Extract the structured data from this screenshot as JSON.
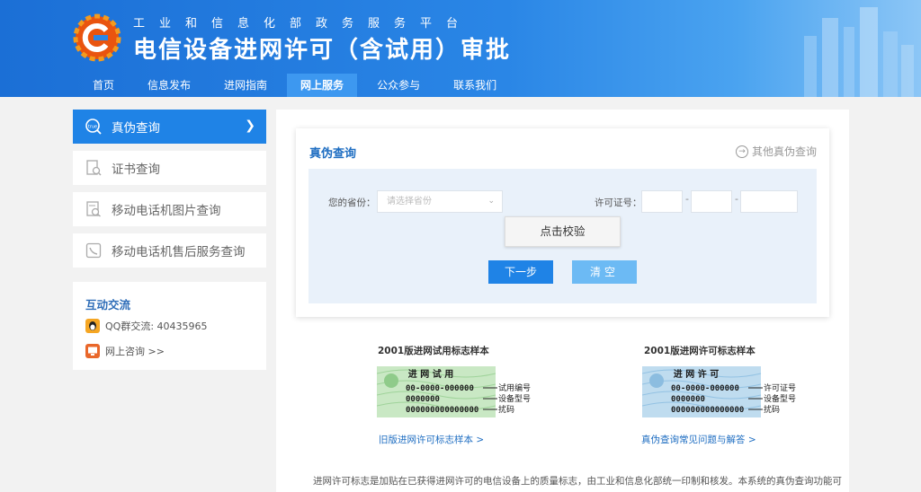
{
  "header": {
    "subtitle": "工业和信息化部政务服务平台",
    "title": "电信设备进网许可（含试用）审批",
    "nav": [
      "首页",
      "信息发布",
      "进网指南",
      "网上服务",
      "公众参与",
      "联系我们"
    ],
    "active_nav": "网上服务"
  },
  "sidebar": {
    "items": [
      {
        "label": "真伪查询",
        "icon": "true-verify-icon",
        "active": true
      },
      {
        "label": "证书查询",
        "icon": "certificate-search-icon"
      },
      {
        "label": "移动电话机图片查询",
        "icon": "phone-image-search-icon"
      },
      {
        "label": "移动电话机售后服务查询",
        "icon": "after-sales-icon"
      }
    ],
    "interact": {
      "title": "互动交流",
      "qq": "QQ群交流: 40435965",
      "online": "网上咨询 >>"
    }
  },
  "query": {
    "title": "真伪查询",
    "other_link": "其他真伪查询",
    "province_label": "您的省份：",
    "province_placeholder": "请选择省份",
    "license_label": "许可证号：",
    "verify_btn": "点击校验",
    "next_btn": "下一步",
    "clear_btn": "清空"
  },
  "samples": {
    "left_title": "2001版进网试用标志样本",
    "left_link": "旧版进网许可标志样本 >",
    "left_label_top": "进 网 试 用",
    "left_code1": "00-0000-000000",
    "left_code2": "0000000",
    "left_code3": "000000000000000",
    "left_ann1": "试用编号",
    "left_ann2": "设备型号",
    "left_ann3": "扰码",
    "right_title": "2001版进网许可标志样本",
    "right_link": "真伪查询常见问题与解答 >",
    "right_label_top": "进 网 许 可",
    "right_ann1": "许可证号",
    "right_ann2": "设备型号",
    "right_ann3": "扰码"
  },
  "footer_text": "进网许可标志是加贴在已获得进网许可的电信设备上的质量标志，由工业和信息化部统一印制和核发。本系统的真伪查询功能可",
  "colors": {
    "primary": "#1f83e6",
    "title_blue": "#1f6ec2",
    "header": "#1b6fd6"
  }
}
